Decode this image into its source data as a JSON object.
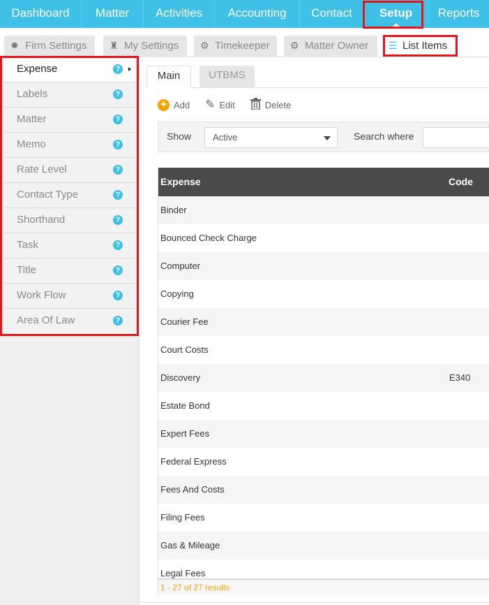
{
  "topnav": {
    "items": [
      {
        "label": "Dashboard"
      },
      {
        "label": "Matter"
      },
      {
        "label": "Activities"
      },
      {
        "label": "Accounting"
      },
      {
        "label": "Contact"
      },
      {
        "label": "Setup"
      },
      {
        "label": "Reports"
      }
    ],
    "active": "Setup"
  },
  "subtabs": [
    {
      "label": "Firm Settings",
      "icon": "gear-icon"
    },
    {
      "label": "My Settings",
      "icon": "user-tie-icon"
    },
    {
      "label": "Timekeeper",
      "icon": "gears-icon"
    },
    {
      "label": "Matter Owner",
      "icon": "gear-icon"
    },
    {
      "label": "List Items",
      "icon": "list-icon"
    }
  ],
  "sidebar": {
    "items": [
      {
        "label": "Expense"
      },
      {
        "label": "Labels"
      },
      {
        "label": "Matter"
      },
      {
        "label": "Memo"
      },
      {
        "label": "Rate Level"
      },
      {
        "label": "Contact Type"
      },
      {
        "label": "Shorthand"
      },
      {
        "label": "Task"
      },
      {
        "label": "Title"
      },
      {
        "label": "Work Flow"
      },
      {
        "label": "Area Of Law"
      }
    ],
    "help_glyph": "?"
  },
  "content_tabs": [
    {
      "label": "Main"
    },
    {
      "label": "UTBMS"
    }
  ],
  "toolbar": {
    "add_label": "Add",
    "edit_label": "Edit",
    "delete_label": "Delete"
  },
  "filter": {
    "show_label": "Show",
    "show_value": "Active",
    "search_label": "Search where",
    "search_value": ""
  },
  "grid": {
    "columns": [
      "Expense",
      "Code"
    ],
    "rows": [
      {
        "expense": "Binder",
        "code": ""
      },
      {
        "expense": "Bounced Check Charge",
        "code": ""
      },
      {
        "expense": "Computer",
        "code": ""
      },
      {
        "expense": "Copying",
        "code": ""
      },
      {
        "expense": "Courier Fee",
        "code": ""
      },
      {
        "expense": "Court Costs",
        "code": ""
      },
      {
        "expense": "Discovery",
        "code": "E340"
      },
      {
        "expense": "Estate Bond",
        "code": ""
      },
      {
        "expense": "Expert Fees",
        "code": ""
      },
      {
        "expense": "Federal Express",
        "code": ""
      },
      {
        "expense": "Fees And Costs",
        "code": ""
      },
      {
        "expense": "Filing Fees",
        "code": ""
      },
      {
        "expense": "Gas & Mileage",
        "code": ""
      },
      {
        "expense": "Legal Fees",
        "code": ""
      }
    ],
    "footer": "1 - 27 of 27 results"
  },
  "colors": {
    "nav": "#3fc0e6",
    "highlight": "#e8141b",
    "accent_orange": "#f5a300",
    "grid_header": "#4a4a4a"
  }
}
